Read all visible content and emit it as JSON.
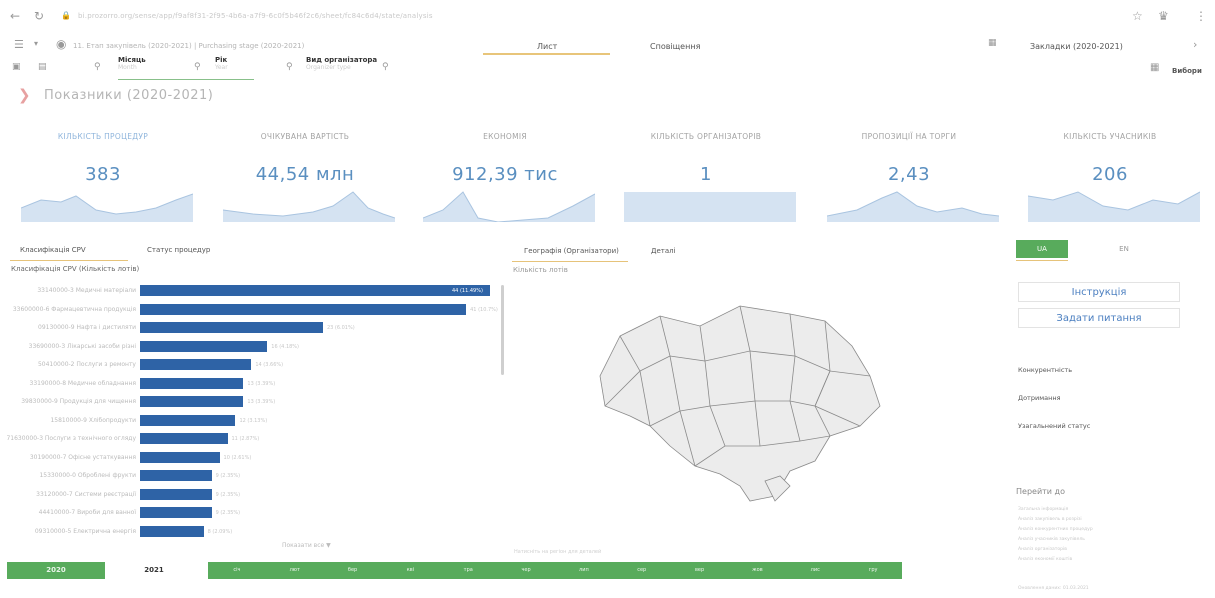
{
  "browser": {
    "url": "bi.prozorro.org/sense/app/f9af8f31-2f95-4b6a-a7f9-6c0f5b46f2c6/sheet/fc84c6d4/state/analysis"
  },
  "app": {
    "sheet_path": "11. Етап закупівель (2020-2021) | Purchasing stage (2020-2021)",
    "tabs": [
      "Лист",
      "Сповіщення"
    ],
    "bookmark_label": "Закладки (2020-2021)",
    "selections_label": "Вибори"
  },
  "filters": [
    {
      "label": "Місяць",
      "sub": "Month"
    },
    {
      "label": "Рік",
      "sub": "Year"
    },
    {
      "label": "Вид організатора",
      "sub": "Organizer type"
    }
  ],
  "page": {
    "title": "Показники (2020-2021)"
  },
  "kpis": [
    {
      "label": "КІЛЬКІСТЬ ПРОЦЕДУР",
      "value": "383"
    },
    {
      "label": "ОЧІКУВАНА ВАРТІСТЬ",
      "value": "44,54 млн"
    },
    {
      "label": "ЕКОНОМІЯ",
      "value": "912,39 тис"
    },
    {
      "label": "КІЛЬКІСТЬ ОРГАНІЗАТОРІВ",
      "value": "1"
    },
    {
      "label": "ПРОПОЗИЦІЇ НА ТОРГИ",
      "value": "2,43"
    },
    {
      "label": "КІЛЬКІСТЬ УЧАСНИКІВ",
      "value": "206"
    }
  ],
  "left_panel": {
    "tabs": [
      "Класифікація CPV",
      "Статус процедур"
    ],
    "chart_title": "Класифікація CPV (Кількість лотів)",
    "more_label": "Показати все ▼",
    "bars": [
      {
        "label": "33140000-3 Медичні матеріали",
        "value": 44,
        "value_label": "44 (11.49%)"
      },
      {
        "label": "33600000-6 Фармацевтична продукція",
        "value": 41,
        "value_label": "41 (10.7%)"
      },
      {
        "label": "09130000-9 Нафта і дистиляти",
        "value": 23,
        "value_label": "23 (6.01%)"
      },
      {
        "label": "33690000-3 Лікарські засоби різні",
        "value": 16,
        "value_label": "16 (4.18%)"
      },
      {
        "label": "50410000-2 Послуги з ремонту",
        "value": 14,
        "value_label": "14 (3.66%)"
      },
      {
        "label": "33190000-8 Медичне обладнання",
        "value": 13,
        "value_label": "13 (3.39%)"
      },
      {
        "label": "39830000-9 Продукція для чищення",
        "value": 13,
        "value_label": "13 (3.39%)"
      },
      {
        "label": "15810000-9 Хлібопродукти",
        "value": 12,
        "value_label": "12 (3.13%)"
      },
      {
        "label": "71630000-3 Послуги з технічного огляду",
        "value": 11,
        "value_label": "11 (2.87%)"
      },
      {
        "label": "30190000-7 Офісне устаткування",
        "value": 10,
        "value_label": "10 (2.61%)"
      },
      {
        "label": "15330000-0 Оброблені фрукти",
        "value": 9,
        "value_label": "9 (2.35%)"
      },
      {
        "label": "33120000-7 Системи реєстрації",
        "value": 9,
        "value_label": "9 (2.35%)"
      },
      {
        "label": "44410000-7 Вироби для ванної",
        "value": 9,
        "value_label": "9 (2.35%)"
      },
      {
        "label": "09310000-5 Електрична енергія",
        "value": 8,
        "value_label": "8 (2.09%)"
      }
    ]
  },
  "middle_panel": {
    "tabs": [
      "Географія (Організатори)",
      "Деталі"
    ],
    "map_title": "Кількість лотів",
    "map_footer": "Натисніть на регіон для деталей"
  },
  "right_panel": {
    "lang": [
      "UA",
      "EN"
    ],
    "instruction_label": "Інструкція",
    "ask_label": "Задати питання",
    "items": [
      "Конкурентність",
      "Дотримання",
      "Узагальнений статус"
    ],
    "goto_title": "Перейти до",
    "goto_items": [
      "Загальна інформація",
      "Аналіз закупівель в розрізі",
      "Аналіз конкурентних процедур",
      "Аналіз учасників закупівель",
      "Аналіз організаторів",
      "Аналіз економії коштів"
    ],
    "footnote": "Оновлення даних: 01.03.2021"
  },
  "timeline": {
    "years": [
      "2020",
      "2021"
    ],
    "months": [
      "січ",
      "лют",
      "бер",
      "кві",
      "тра",
      "чер",
      "лип",
      "сер",
      "вер",
      "жов",
      "лис",
      "гру"
    ]
  },
  "chart_data": {
    "type": "bar",
    "title": "Класифікація CPV (Кількість лотів)",
    "categories": [
      "33140000-3",
      "33600000-6",
      "09130000-9",
      "33690000-3",
      "50410000-2",
      "33190000-8",
      "39830000-9",
      "15810000-9",
      "71630000-3",
      "30190000-7",
      "15330000-0",
      "33120000-7",
      "44410000-7",
      "09310000-5"
    ],
    "values": [
      44,
      41,
      23,
      16,
      14,
      13,
      13,
      12,
      11,
      10,
      9,
      9,
      9,
      8
    ],
    "xlim": [
      0,
      44
    ]
  },
  "colors": {
    "accent_blue": "#2e63a6",
    "kpi_value": "#5a8fc0",
    "green": "#58ab5c",
    "tab_underline": "#e8c57a"
  }
}
